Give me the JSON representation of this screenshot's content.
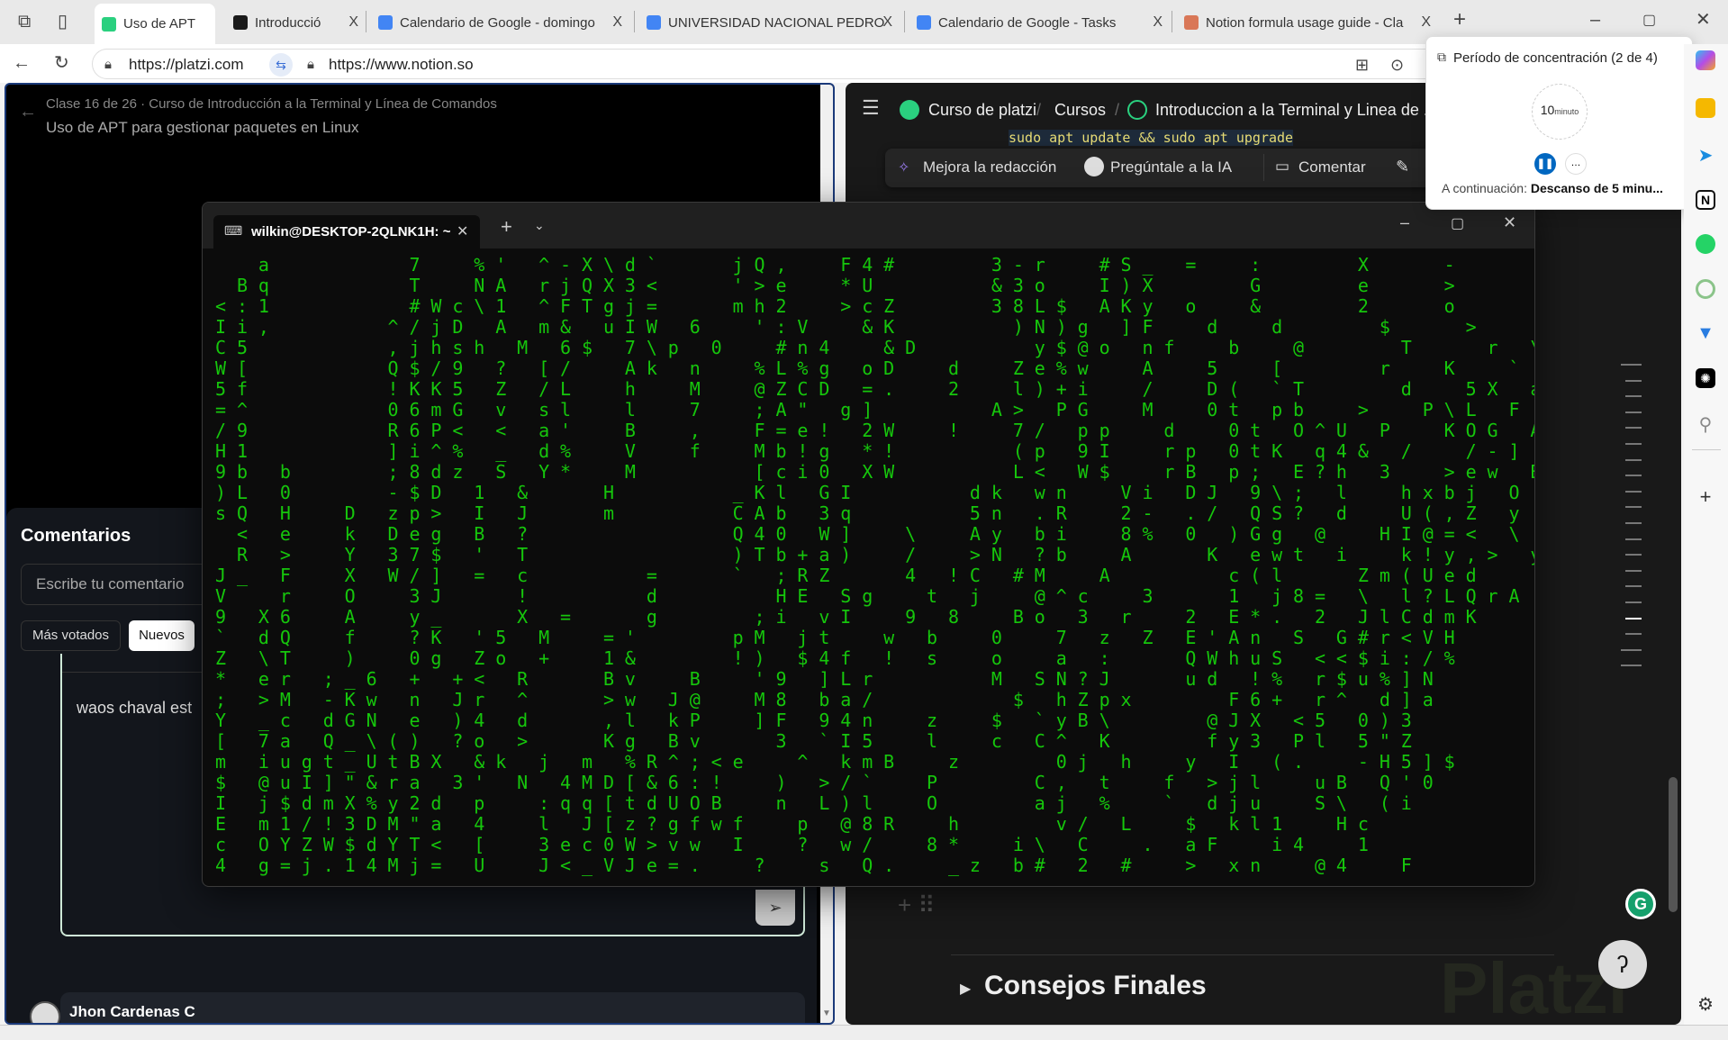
{
  "browser": {
    "tabs": [
      {
        "label": "Uso de APT",
        "active": true,
        "color": "#2ad07f"
      },
      {
        "label": "Introducció",
        "color": "#1a1a1a"
      },
      {
        "label": "Calendario de Google - domingo",
        "color": "#4285f4"
      },
      {
        "label": "UNIVERSIDAD NACIONAL PEDRO",
        "color": "#4285f4"
      },
      {
        "label": "Calendario de Google - Tasks",
        "color": "#4285f4"
      },
      {
        "label": "Notion formula usage guide - Cla",
        "color": "#d97757"
      }
    ],
    "close_glyph": "X",
    "url_left": "https://platzi.com",
    "url_right": "https://www.notion.so"
  },
  "platzi": {
    "breadcrumb": "Clase 16 de 26 · Curso de Introducción a la Terminal y Línea de Comandos",
    "title": "Uso de APT para gestionar paquetes en Linux",
    "comments_title": "Comentarios",
    "comment_placeholder": "Escribe tu comentario",
    "filter_top": "Más votados",
    "filter_new": "Nuevos",
    "draft_text": "waos chaval est",
    "comment_author": "Jhon Cardenas C"
  },
  "notion": {
    "breadcrumbs": [
      "Curso de platzi",
      "Cursos",
      "Introduccion a la Terminal y Linea de ..."
    ],
    "code_line": "sudo apt update && sudo apt upgrade",
    "toolbar": {
      "improve": "Mejora la redacción",
      "ask_ai": "Pregúntale a la IA",
      "comment": "Comentar"
    },
    "toggle_heading": "Consejos Finales",
    "watermark": "Platzi"
  },
  "terminal": {
    "tab_title": "wilkin@DESKTOP-2QLNK1H: ~",
    "text_color": "#16c60c",
    "rows": [
      "  a      7  %' ^-X\\d`   jQ,  F4#    3-r  #S_ =  :    X   -  ",
      " Bq      T  NA rjQX3<   '>e  *U     &3o  I)X    G    e   >  ",
      "<:1      #Wc\\1 ^FTgj=   mh2  >cZ    38L$ AKy o  &    2   o  ",
      "Ii,     ^/jD A m& uIW 6  ':V  &K     )N)g ]F  d  d    $   >  ",
      "C5      ,jhsh M 6$ 7\\p 0  #n4  &D     y$@o nf  b  @    T   r \\",
      "W[      Q$/9 ? [/  Ak n  %L%g oD  d  Ze%w  A  5  [    r  K  `",
      "5f      !KK5 Z /L  h  M  @ZCD =.  2  l)+i  /  D( `T    d  5X a",
      "=^      06mG v sl  l  7  ;A\" g]     A> PG  M  0t pb  >  P\\L F",
      "/9      R6P< < a'  B  ,  F=e! 2W  !  7/ pp  d  0t O^U P  KOG A",
      "H1      ]i^% _ d%  V  f  Mb!g *!     (p 9I  rp 0tK q4& /  /-] Y",
      "9b b    ;8dz S Y*  M     [ci0 XW     L< W$  rB p; E?h 3  >ew B",
      ")L 0    -$D 1 &   H     _Kl GI     dk wn  Vi DJ 9\\; l  hxbj O",
      "sQ H  D zp> I J   m     CAb 3q     5n .R  2- ./ QS? d  U(,Z y",
      " < e  k Deg B ?         Q40 W]  \\  Ay bi  8% 0 )Gg @  HI@=< \\",
      " R >  Y 37$ ' T         )Tb+a)  /  >N ?b  A   K ewt i  k!y,> y",
      "J_ F  X W/] = c     =   ` ;RZ   4 !C #M  A     c(l   Zm(Ued ",
      "V  r  O  3J   !     d     HE Sg  t j  @^c  3   1 j8= \\ l?LQrA ",
      "9 X6  A  y_   X =   g    ;i vI  9 8  Bo 3 r  2 E*. 2 JlCdmK ",
      "` dQ  f  ?K '5 M  ='    pM jt  w b  0  7 z Z E'An S G#r<VH ",
      "Z \\T  )  0g Zo +  1&    !) $4f ! s  o  a :   QWhuS <<$i:/% ",
      "* er ;_6 + +< R   Bv  B  '9 ]Lr     M SN?J   ud !% r$u%]N ",
      "; >M -Kw n Jr ^   >w J@  M8 ba/      $ hZpx    F6+ r^ d]a ",
      "Y _c dGN e )4 d   ,l kP  ]F 94n  z  $ `yB\\    @JX <5 0)3 ",
      "[ 7a Q_\\() ?o >   Kg Bv   3 `I5  l  c C^ K    fy3 Pl 5\"Z ",
      "m iugt_UtBX &k j m %R^;<e  ^ kmB  z    0j h  y I (.  -H5]$ ",
      "$ @uI]\"&ra 3' N 4MD[&6:!  ) >/`  P    C, t  f >jl  uB Q'0 ",
      "I j$dmX%y2d p  :qq[tdUOB  n L)l  O    aj %  ` dju  S\\ (i ",
      "E m1/!3DM\"a 4  l J[z?gfwf  p @8R  h    v/ L  $ kl1  Hc  ",
      "c OYZW$dYT< [  3ec0W>vw I  ? w/  8*  i\\ C  . aF  i4  1 ",
      "4 g=j.14Mj= U  J<_VJe=.  ?  s Q.  _z b# 2 #  > xn  @4  F "
    ]
  },
  "focus_popup": {
    "title": "Período de concentración (2 de 4)",
    "timer_value": "10",
    "timer_unit": "minuto",
    "next_label": "A continuación:",
    "next_value": "Descanso de 5 minu...",
    "accent": "#0067c0"
  },
  "edge_sidebar": {
    "icons": [
      "copilot-icon",
      "tips-icon",
      "telegram-icon",
      "notion-icon",
      "whatsapp-icon",
      "app-icon",
      "arrow-icon",
      "chatgpt-icon",
      "search-icon",
      "add-icon",
      "settings-icon"
    ]
  }
}
